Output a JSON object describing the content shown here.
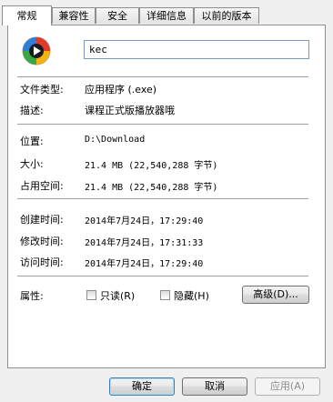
{
  "tabs": [
    "常规",
    "兼容性",
    "安全",
    "详细信息",
    "以前的版本"
  ],
  "general": {
    "icon": "media-player-app-icon",
    "file_name": "kec",
    "file_type_label": "文件类型:",
    "file_type_value": "应用程序 (.exe)",
    "description_label": "描述:",
    "description_value": "课程正式版播放器哦",
    "location_label": "位置:",
    "location_value": "D:\\Download",
    "size_label": "大小:",
    "size_value": "21.4 MB (22,540,288 字节)",
    "size_on_disk_label": "占用空间:",
    "size_on_disk_value": "21.4 MB (22,540,288 字节)",
    "created_label": "创建时间:",
    "created_value": "2014年7月24日，17:29:40",
    "modified_label": "修改时间:",
    "modified_value": "2014年7月24日，17:31:33",
    "accessed_label": "访问时间:",
    "accessed_value": "2014年7月24日，17:29:40",
    "attributes_label": "属性:",
    "readonly_label": "只读(R)",
    "hidden_label": "隐藏(H)",
    "advanced_label": "高级(D)..."
  },
  "footer": {
    "ok_label": "确定",
    "cancel_label": "取消",
    "apply_label": "应用(A)"
  }
}
